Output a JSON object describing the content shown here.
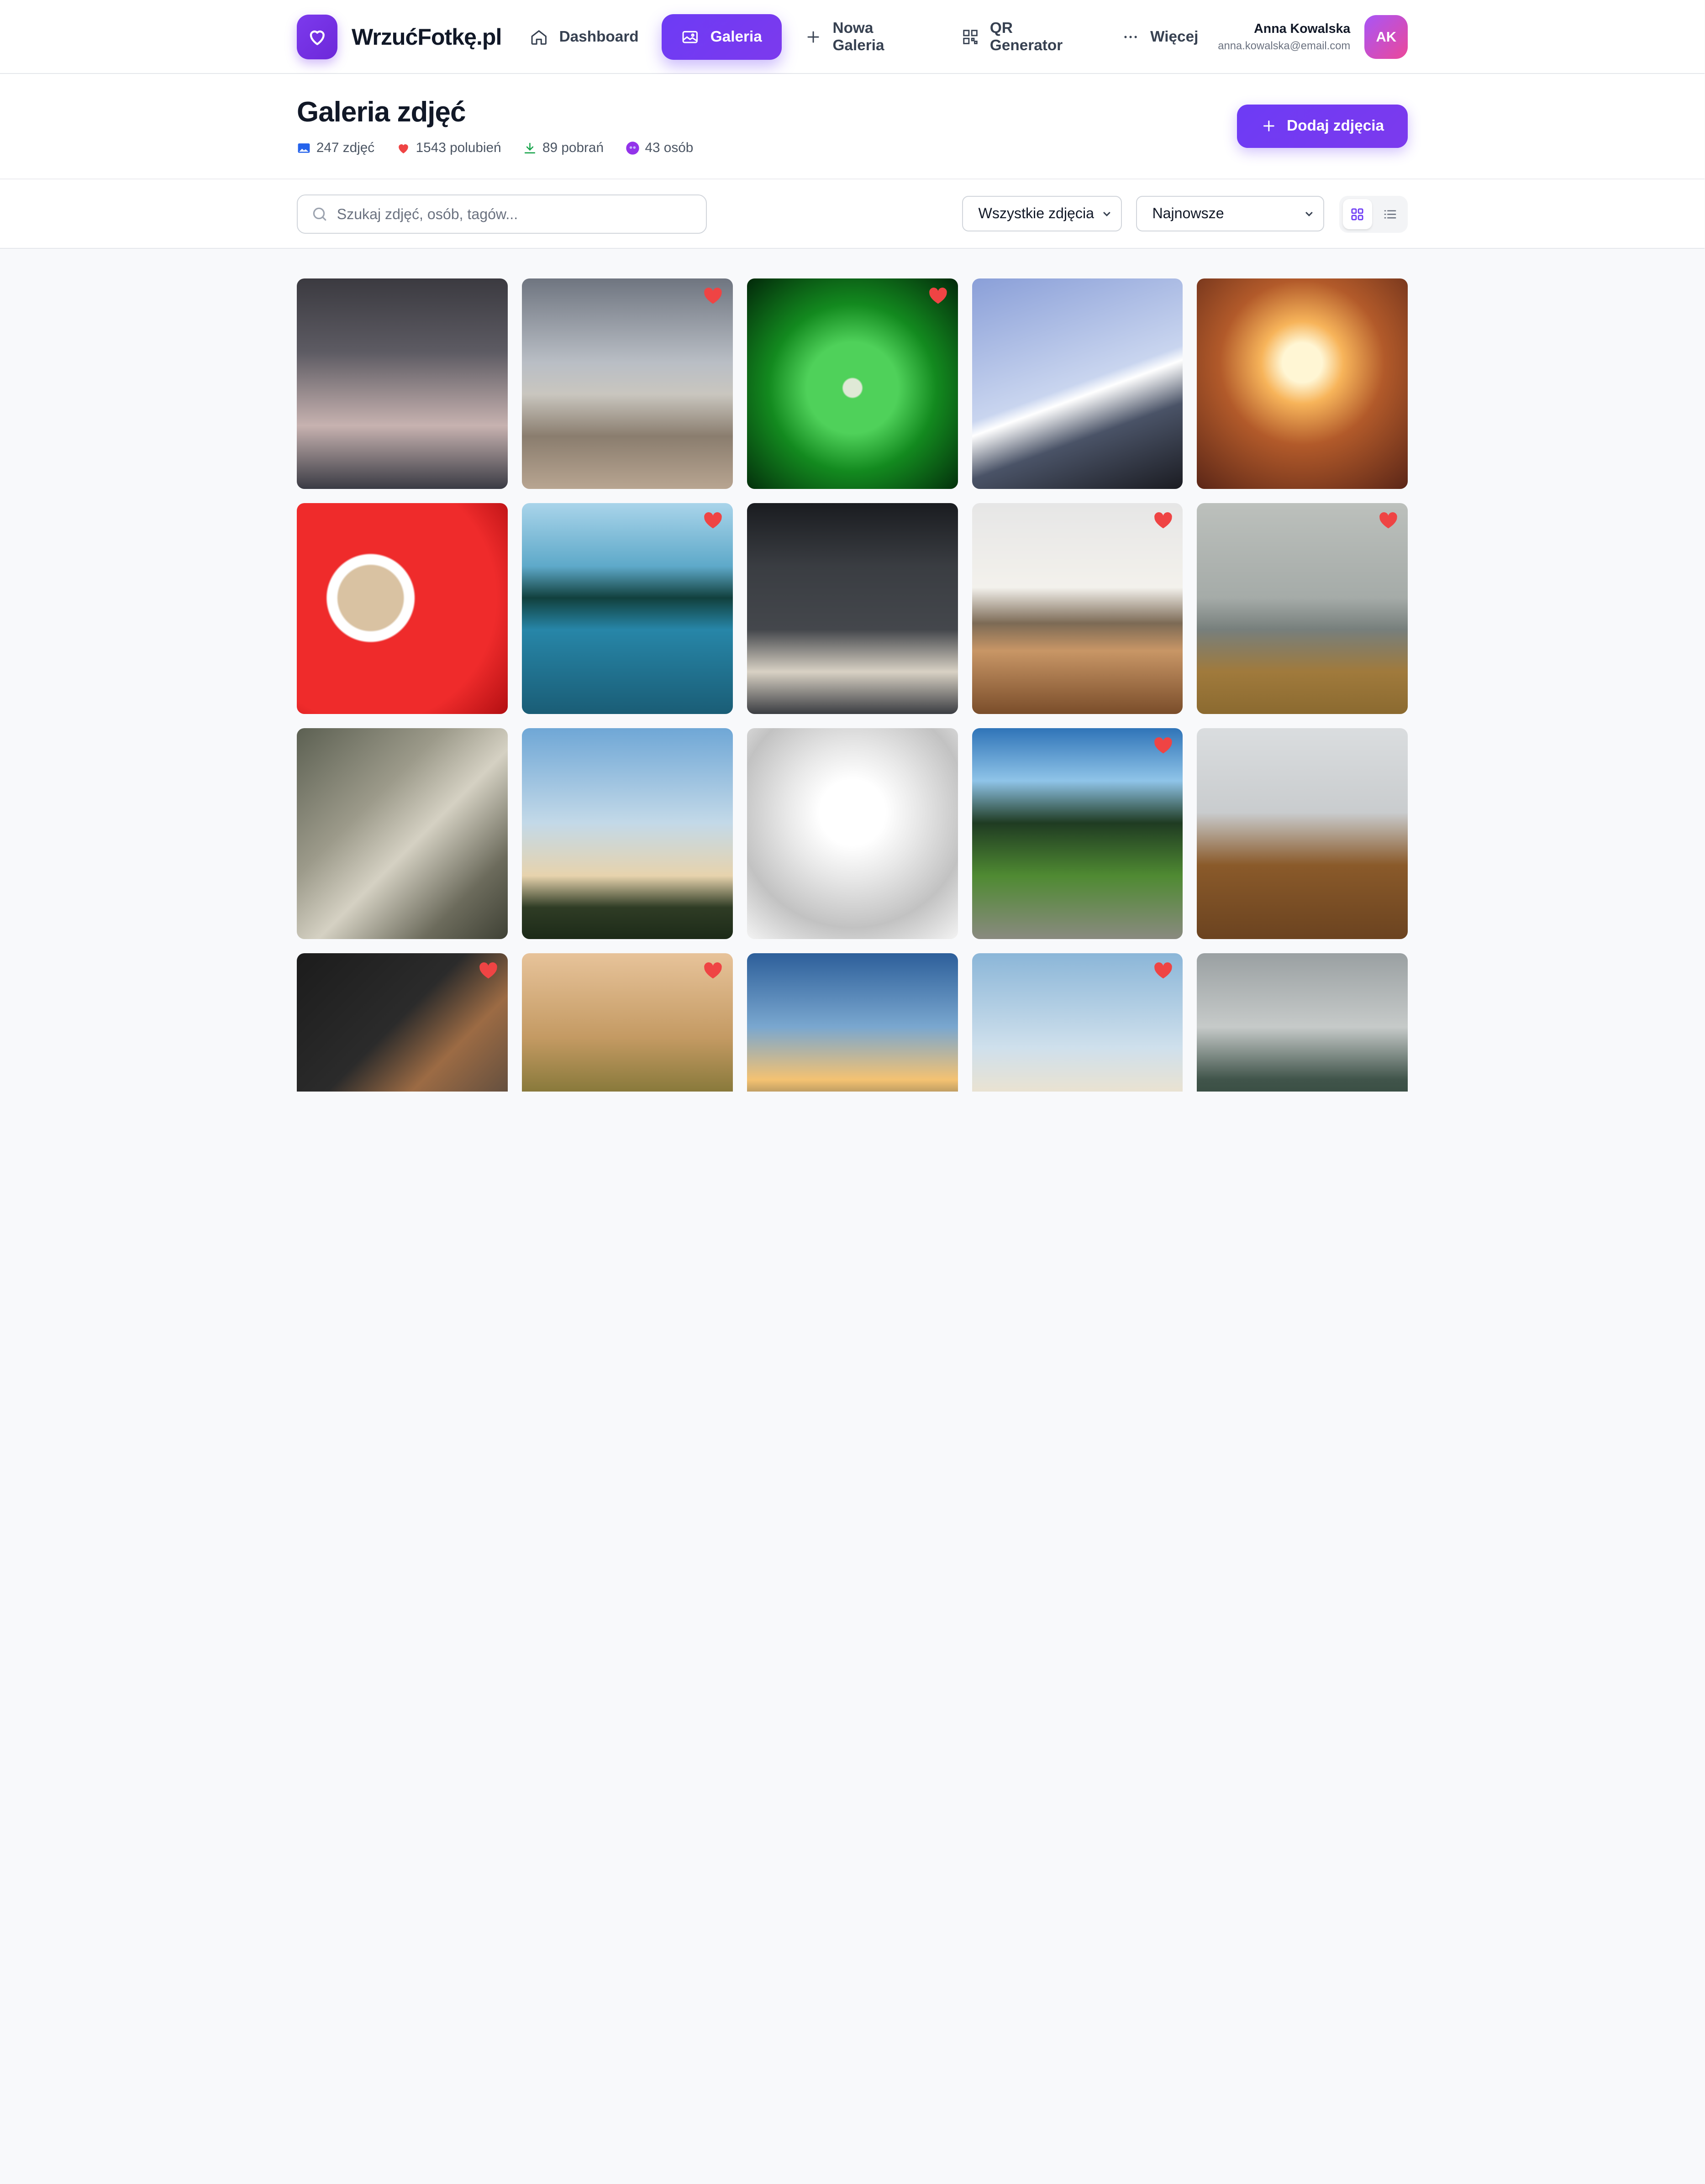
{
  "nav": {
    "logo_text": "WrzućFotkę.pl",
    "items": [
      {
        "label": "Dashboard",
        "icon": "home-icon"
      },
      {
        "label": "Galeria",
        "icon": "image-icon",
        "active": true
      },
      {
        "label": "Nowa Galeria",
        "icon": "plus-icon"
      },
      {
        "label": "QR Generator",
        "icon": "qr-icon"
      },
      {
        "label": "Więcej",
        "icon": "more-icon"
      }
    ],
    "user": {
      "name": "Anna Kowalska",
      "email": "anna.kowalska@email.com",
      "initials": "AK"
    }
  },
  "header": {
    "title": "Galeria zdjęć",
    "stats": {
      "photos": "247 zdjęć",
      "likes": "1543 polubień",
      "downloads": "89 pobrań",
      "people": "43 osób"
    },
    "add_button": "Dodaj zdjęcia"
  },
  "toolbar": {
    "search_placeholder": "Szukaj zdjęć, osób, tagów...",
    "filter_value": "Wszystkie zdjęcia",
    "sort_value": "Najnowsze",
    "view_mode": "grid"
  },
  "colors": {
    "accent": "#6d3bf5",
    "heart": "#ef4444"
  },
  "gallery": {
    "photos": [
      {
        "subject": "skyscraper at dusk",
        "liked": false
      },
      {
        "subject": "misty beach",
        "liked": true
      },
      {
        "subject": "water drop on green leaf",
        "liked": true
      },
      {
        "subject": "snowy mountain peak",
        "liked": false
      },
      {
        "subject": "courtyard looking up at sun",
        "liked": false
      },
      {
        "subject": "coffee cup on red",
        "liked": false
      },
      {
        "subject": "woman in canoe on lake",
        "liked": true
      },
      {
        "subject": "desk with keyboard flatlay",
        "liked": false
      },
      {
        "subject": "calm lake shore",
        "liked": true
      },
      {
        "subject": "hay bale in fog",
        "liked": true
      },
      {
        "subject": "city rooftops aerial",
        "liked": false
      },
      {
        "subject": "palm trees sky",
        "liked": false
      },
      {
        "subject": "white dome interior",
        "liked": false
      },
      {
        "subject": "forest path",
        "liked": true
      },
      {
        "subject": "person in beanie and jacket",
        "liked": false
      },
      {
        "subject": "person typing on laptop",
        "liked": true
      },
      {
        "subject": "cactus field at sunset",
        "liked": true
      },
      {
        "subject": "sunset road",
        "liked": false
      },
      {
        "subject": "father carrying child on beach",
        "liked": true
      },
      {
        "subject": "misty forest hills",
        "liked": false
      }
    ]
  }
}
